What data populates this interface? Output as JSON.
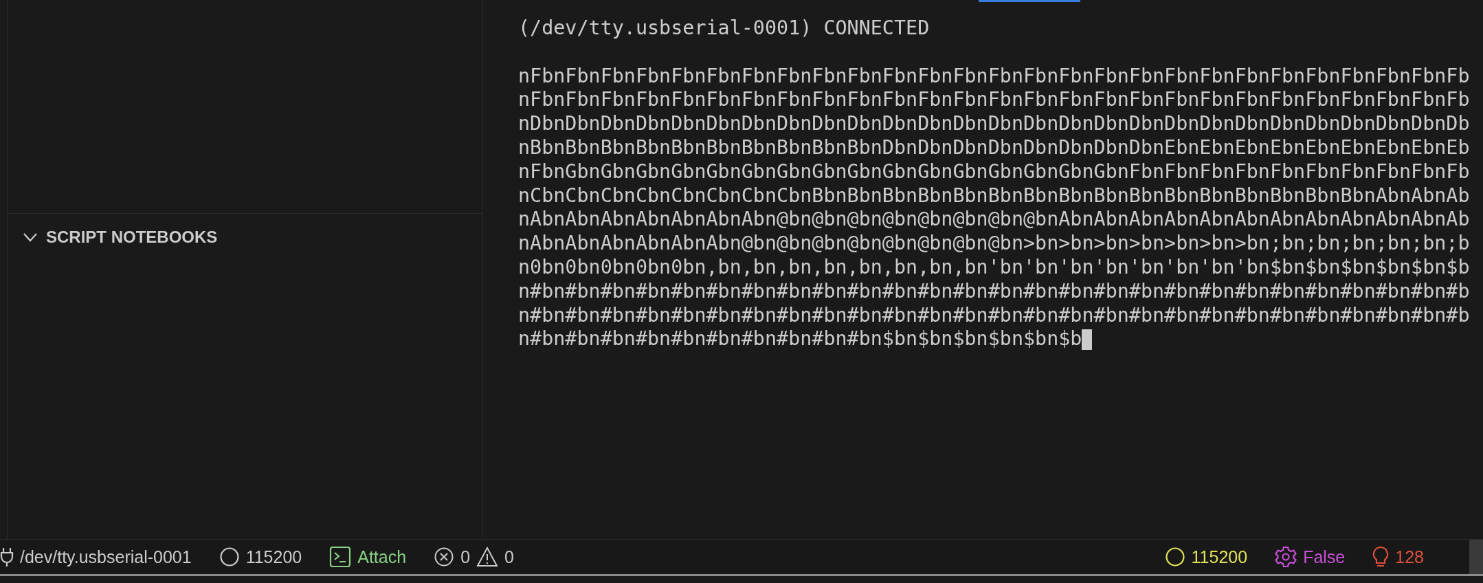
{
  "sidebar": {
    "section": {
      "title": "SCRIPT NOTEBOOKS",
      "expanded": true
    }
  },
  "terminal": {
    "status_line": "(/dev/tty.usbserial-0001) CONNECTED",
    "lines": [
      "nFbnFbnFbnFbnFbnFbnFbnFbnFbnFbnFbnFbnFbnFbnFbnFbnFbnFbnFbnFbnFbnFbnFbnFbnFbnFbnFb",
      "nFbnFbnFbnFbnFbnFbnFbnFbnFbnFbnFbnFbnFbnFbnFbnFbnFbnFbnFbnFbnFbnFbnFbnFbnFbnFbnFb",
      "nDbnDbnDbnDbnDbnDbnDbnDbnDbnDbnDbnDbnDbnDbnDbnDbnDbnDbnDbnDbnDbnDbnDbnDbnDbnDbnDb",
      "nBbnBbnBbnBbnBbnBbnBbnBbnBbnBbnDbnDbnDbnDbnDbnDbnDbnDbnEbnEbnEbnEbnEbnEbnEbnEbnEb",
      "nFbnGbnGbnGbnGbnGbnGbnGbnGbnGbnGbnGbnGbnGbnGbnGbnGbnFbnFbnFbnFbnFbnFbnFbnFbnFbnFb",
      "nCbnCbnCbnCbnCbnCbnCbnCbnBbnBbnBbnBbnBbnBbnBbnBbnBbnBbnBbnBbnBbnBbnBbnBbnAbnAbnAb",
      "nAbnAbnAbnAbnAbnAbnAbn@bn@bn@bn@bn@bn@bn@bn@bnAbnAbnAbnAbnAbnAbnAbnAbnAbnAbnAbnAb",
      "nAbnAbnAbnAbnAbnAbn@bn@bn@bn@bn@bn@bn@bn@bn>bn>bn>bn>bn>bn>bn>bn;bn;bn;bn;bn;bn;b",
      "n0bn0bn0bn0bn0bn,bn,bn,bn,bn,bn,bn,bn,bn'bn'bn'bn'bn'bn'bn'bn'bn$bn$bn$bn$bn$bn$b",
      "n#bn#bn#bn#bn#bn#bn#bn#bn#bn#bn#bn#bn#bn#bn#bn#bn#bn#bn#bn#bn#bn#bn#bn#bn#bn#bn#b",
      "n#bn#bn#bn#bn#bn#bn#bn#bn#bn#bn#bn#bn#bn#bn#bn#bn#bn#bn#bn#bn#bn#bn#bn#bn#bn#bn#b",
      "n#bn#bn#bn#bn#bn#bn#bn#bn#bn#bn$bn$bn$bn$bn$bn$b"
    ],
    "cursor": true
  },
  "status_bar": {
    "left": [
      {
        "kind": "port",
        "text": "/dev/tty.usbserial-0001",
        "color": "#cccccc"
      },
      {
        "kind": "baud",
        "text": "115200",
        "color": "#cccccc"
      },
      {
        "kind": "attach",
        "text": "Attach",
        "color": "#89d185"
      },
      {
        "kind": "problems",
        "errors": "0",
        "warnings": "0",
        "color": "#cccccc"
      }
    ],
    "right": [
      {
        "kind": "baud",
        "text": "115200",
        "color": "#e2e25a"
      },
      {
        "kind": "setting",
        "text": "False",
        "color": "#c94fd8"
      },
      {
        "kind": "bulb",
        "text": "128",
        "color": "#e0503c"
      }
    ]
  }
}
